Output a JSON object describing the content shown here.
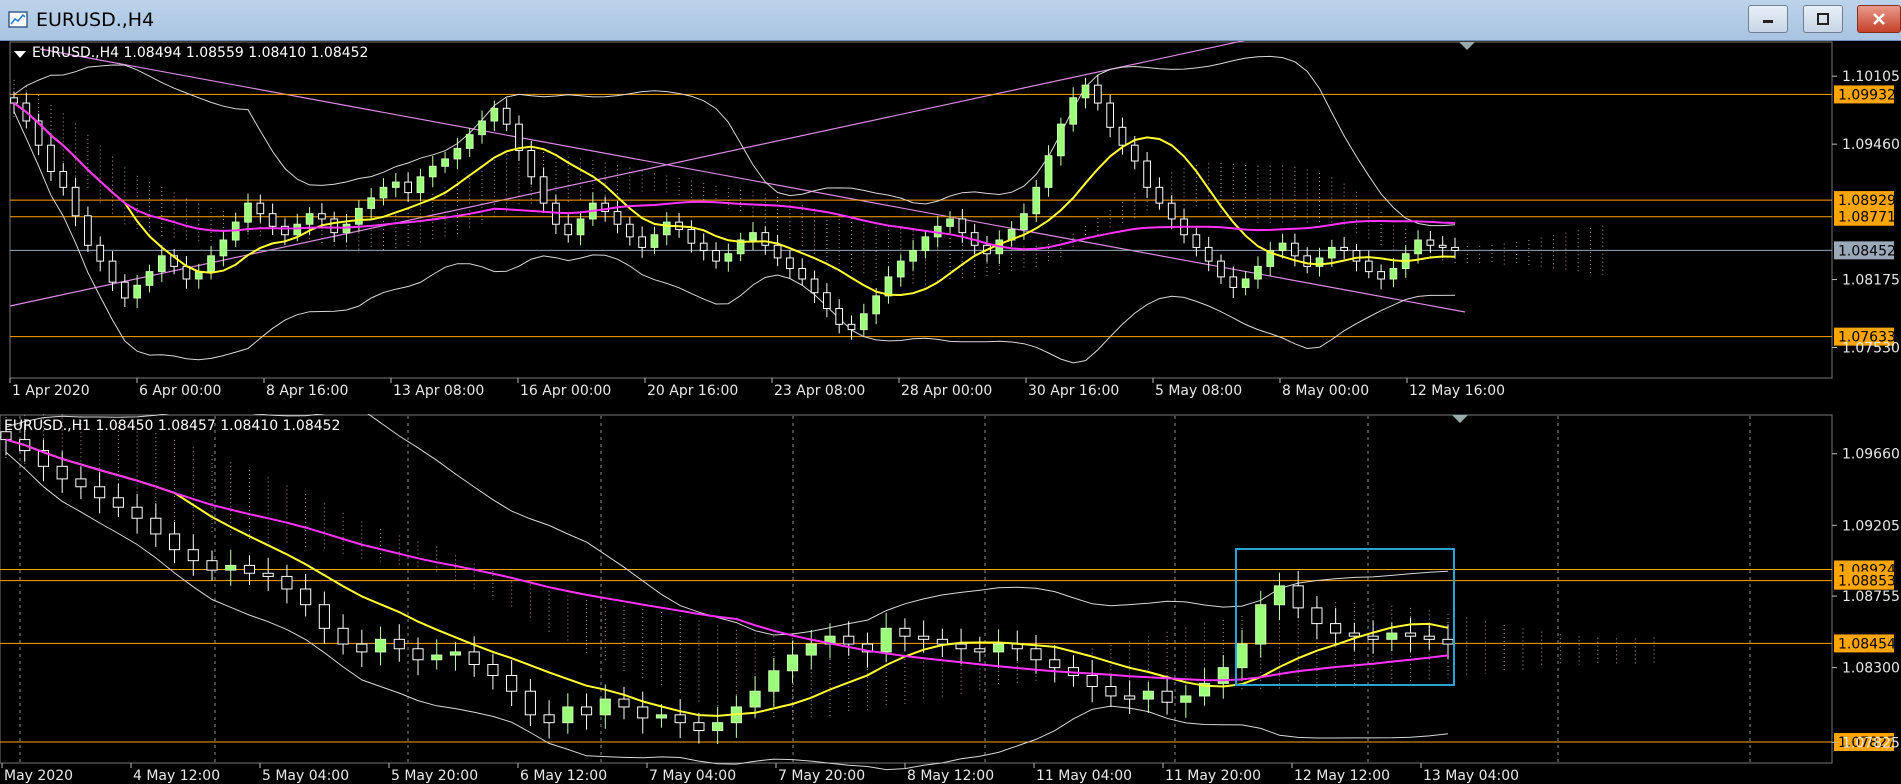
{
  "window": {
    "title": "EURUSD.,H4"
  },
  "panes": [
    {
      "id": "h4",
      "header": "EURUSD.,H4  1.08494 1.08559 1.08410 1.08452",
      "price_min": 1.0725,
      "price_max": 1.1042,
      "axis_ticks": [
        "1.10105",
        "1.09460",
        "1.08175",
        "1.07530"
      ],
      "tick_values": [
        1.10105,
        1.0946,
        1.08175,
        1.0753
      ],
      "hlines": [
        {
          "value": 1.09932,
          "label": "1.09932",
          "color": "#ffa500"
        },
        {
          "value": 1.08929,
          "label": "1.08929",
          "color": "#ffa500"
        },
        {
          "value": 1.08771,
          "label": "1.08771",
          "color": "#ffa500"
        },
        {
          "value": 1.07633,
          "label": "1.07633",
          "color": "#ffa500"
        },
        {
          "value": 1.08452,
          "label": "1.08452",
          "color": "#9aa8b8"
        }
      ],
      "time_labels": [
        "1 Apr 2020",
        "6 Apr 00:00",
        "8 Apr 16:00",
        "13 Apr 08:00",
        "16 Apr 00:00",
        "20 Apr 16:00",
        "23 Apr 08:00",
        "28 Apr 00:00",
        "30 Apr 16:00",
        "5 May 08:00",
        "8 May 00:00",
        "12 May 16:00"
      ],
      "closes": [
        1.0985,
        1.0968,
        1.0945,
        1.092,
        1.0905,
        1.0878,
        1.085,
        1.0835,
        1.0815,
        1.08,
        1.0812,
        1.0825,
        1.084,
        1.083,
        1.0818,
        1.0825,
        1.084,
        1.0855,
        1.0872,
        1.089,
        1.088,
        1.0868,
        1.086,
        1.087,
        1.088,
        1.0875,
        1.0862,
        1.087,
        1.0885,
        1.0895,
        1.0905,
        1.091,
        1.09,
        1.0915,
        1.0925,
        1.0932,
        1.0942,
        1.0955,
        1.0968,
        1.098,
        1.0965,
        1.094,
        1.0915,
        1.089,
        1.087,
        1.086,
        1.0875,
        1.089,
        1.0882,
        1.087,
        1.0858,
        1.0848,
        1.086,
        1.0872,
        1.0865,
        1.0852,
        1.0845,
        1.0835,
        1.0842,
        1.0855,
        1.0862,
        1.085,
        1.0838,
        1.0828,
        1.0818,
        1.0805,
        1.079,
        1.0775,
        1.077,
        1.0785,
        1.0802,
        1.082,
        1.0835,
        1.0845,
        1.0858,
        1.0868,
        1.0875,
        1.0862,
        1.085,
        1.0842,
        1.0855,
        1.0865,
        1.088,
        1.0905,
        1.0935,
        1.0965,
        1.099,
        1.1002,
        1.0985,
        1.0962,
        1.0945,
        1.093,
        1.0905,
        1.089,
        1.0875,
        1.086,
        1.0848,
        1.0835,
        1.082,
        1.081,
        1.0818,
        1.083,
        1.0845,
        1.0852,
        1.084,
        1.083,
        1.0838,
        1.0848,
        1.0845,
        1.0835,
        1.0825,
        1.0818,
        1.0828,
        1.0842,
        1.0855,
        1.085,
        1.0848,
        1.0845
      ],
      "annotations": {
        "current_price": "1.08452"
      }
    },
    {
      "id": "h1",
      "header": "EURUSD.,H1  1.08450 1.08457 1.08410 1.08452",
      "price_min": 1.077,
      "price_max": 1.099,
      "axis_ticks": [
        "1.09660",
        "1.09205",
        "1.08755",
        "1.08300",
        "1.07825"
      ],
      "tick_values": [
        1.0966,
        1.09205,
        1.08755,
        1.083,
        1.07825
      ],
      "hlines": [
        {
          "value": 1.08924,
          "label": "1.08924",
          "color": "#ffa500"
        },
        {
          "value": 1.08853,
          "label": "1.08853",
          "color": "#ffa500"
        },
        {
          "value": 1.08454,
          "label": "1.08454",
          "color": "#ffa500"
        },
        {
          "value": 1.07827,
          "label": "1.07827",
          "color": "#ffa500"
        }
      ],
      "time_labels": [
        "May 2020",
        "4 May 12:00",
        "5 May 04:00",
        "5 May 20:00",
        "6 May 12:00",
        "7 May 04:00",
        "7 May 20:00",
        "8 May 12:00",
        "11 May 04:00",
        "11 May 20:00",
        "12 May 12:00",
        "13 May 04:00"
      ],
      "closes": [
        1.0975,
        1.0968,
        1.0958,
        1.095,
        1.0945,
        1.0938,
        1.0932,
        1.0925,
        1.0915,
        1.0905,
        1.0898,
        1.0892,
        1.0895,
        1.089,
        1.0888,
        1.088,
        1.087,
        1.0855,
        1.0845,
        1.084,
        1.0848,
        1.0842,
        1.0835,
        1.0838,
        1.084,
        1.0832,
        1.0825,
        1.0815,
        1.08,
        1.0795,
        1.0805,
        1.08,
        1.081,
        1.0805,
        1.0798,
        1.08,
        1.0795,
        1.079,
        1.0795,
        1.0805,
        1.0815,
        1.0828,
        1.0838,
        1.0845,
        1.085,
        1.0845,
        1.084,
        1.0855,
        1.085,
        1.0848,
        1.0845,
        1.0842,
        1.084,
        1.0845,
        1.0842,
        1.0835,
        1.083,
        1.0825,
        1.0818,
        1.0812,
        1.081,
        1.0815,
        1.0808,
        1.0812,
        1.082,
        1.083,
        1.0845,
        1.087,
        1.0882,
        1.0868,
        1.0858,
        1.0852,
        1.085,
        1.0848,
        1.0852,
        1.085,
        1.0848,
        1.0845
      ],
      "annotations": {
        "current_price": "1.08454"
      }
    }
  ],
  "colors": {
    "bull_candle": "#c8ffb0",
    "bear_candle": "#ffffff",
    "ma_fast": "#ffff33",
    "ma_slow": "#ff33ff",
    "bands": "#d8d8d8",
    "cloud": "#ffc8c8",
    "level": "#ffa500",
    "trendline": "#d78be0",
    "highlight_box": "#29a3d6",
    "grid": "#c8c8c8"
  }
}
